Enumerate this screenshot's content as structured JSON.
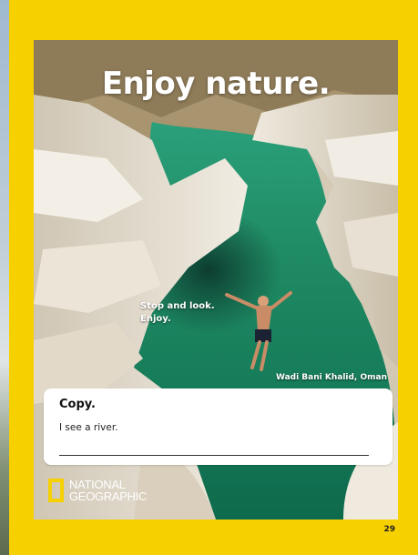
{
  "page": {
    "headline": "Enjoy nature.",
    "caption_lines": [
      "Stop and look.",
      "Enjoy."
    ],
    "location": "Wadi Bani Khalid, Oman",
    "page_number": "29"
  },
  "copy_box": {
    "title": "Copy.",
    "sentence": "I see a river."
  },
  "logo": {
    "lines": [
      "NATIONAL",
      "GEOGRAPHIC"
    ],
    "icon": "national-geographic-frame-icon"
  },
  "colors": {
    "border_yellow": "#f7d000",
    "water_green": "#1f8f6a",
    "rock": "#e6e0d4"
  }
}
